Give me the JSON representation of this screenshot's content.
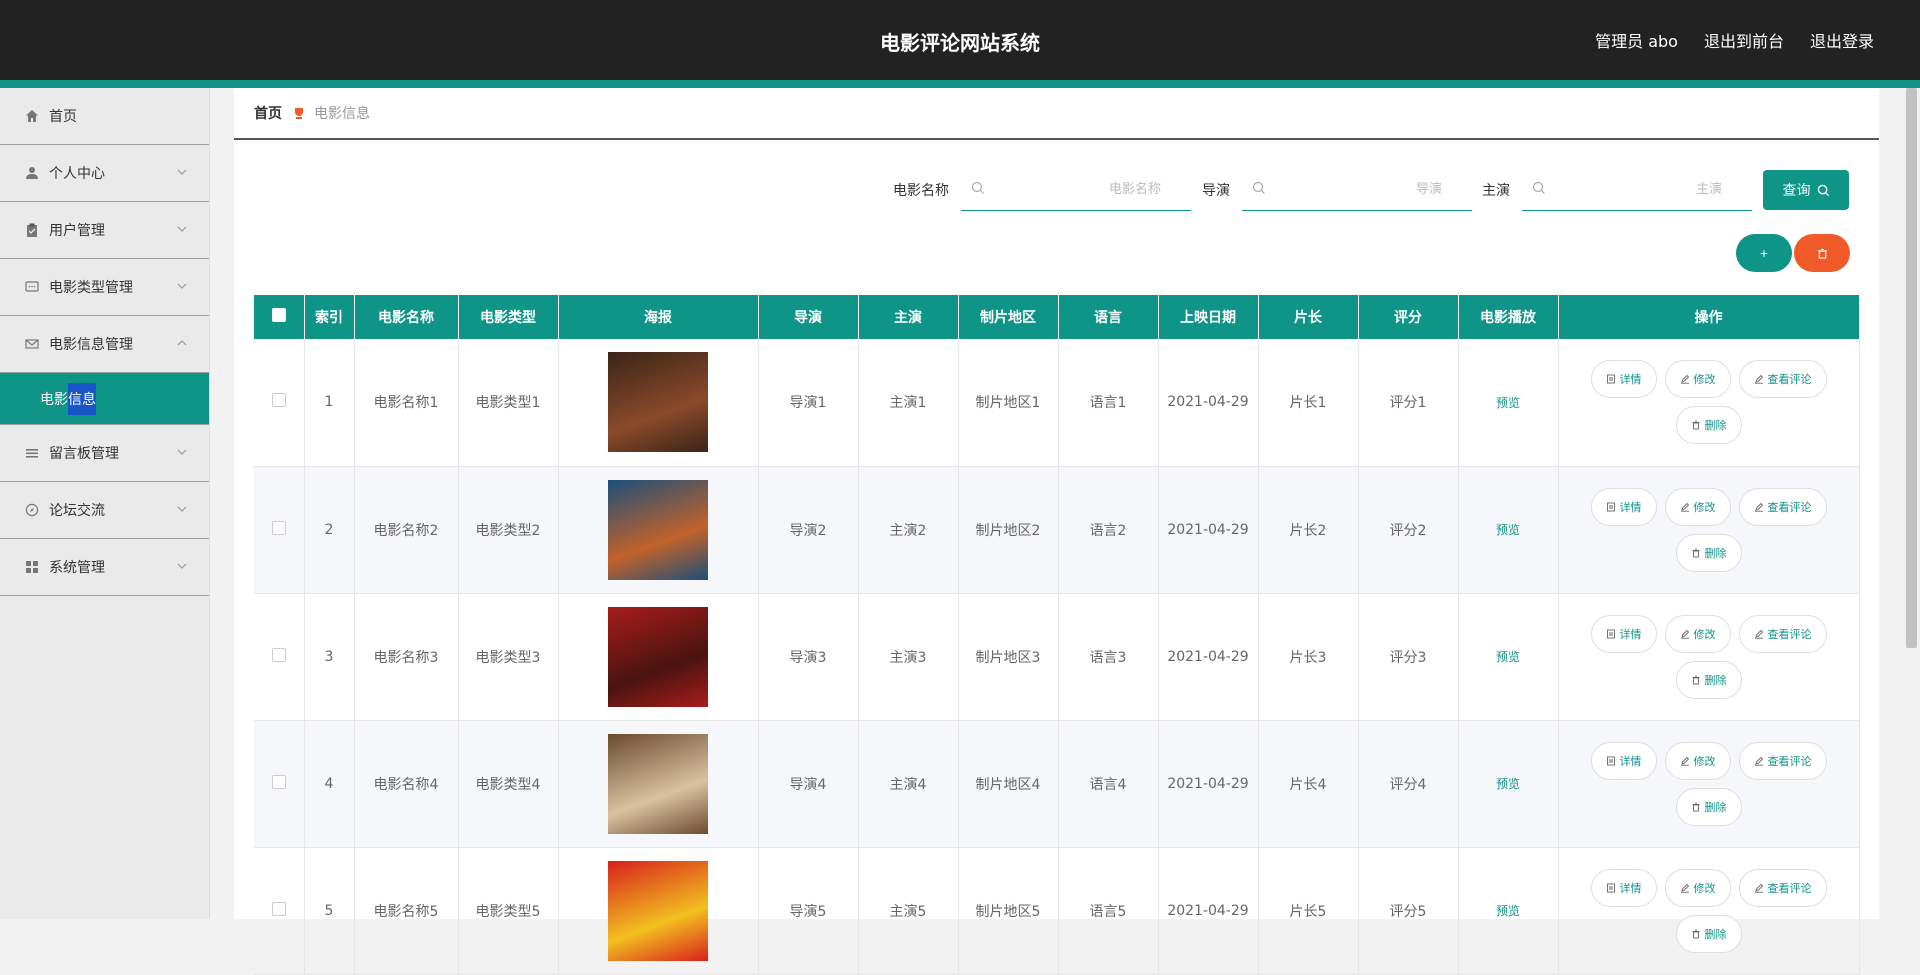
{
  "header": {
    "title": "电影评论网站系统",
    "user_label": "管理员 abo",
    "to_front": "退出到前台",
    "logout": "退出登录"
  },
  "sidebar": {
    "items": [
      {
        "label": "首页",
        "icon": "home-icon"
      },
      {
        "label": "个人中心",
        "icon": "user-icon"
      },
      {
        "label": "用户管理",
        "icon": "clipboard-icon"
      },
      {
        "label": "电影类型管理",
        "icon": "chat-icon"
      },
      {
        "label": "电影信息管理",
        "icon": "mail-icon"
      },
      {
        "label": "留言板管理",
        "icon": "list-icon"
      },
      {
        "label": "论坛交流",
        "icon": "compass-icon"
      },
      {
        "label": "系统管理",
        "icon": "grid-icon"
      }
    ],
    "sub_active_pre": "电影",
    "sub_active_hl": "信息"
  },
  "breadcrumb": {
    "home": "首页",
    "current": "电影信息"
  },
  "search": {
    "name_label": "电影名称",
    "name_placeholder": "电影名称",
    "director_label": "导演",
    "director_placeholder": "导演",
    "actor_label": "主演",
    "actor_placeholder": "主演",
    "query_label": "查询"
  },
  "actions": {
    "add": "+",
    "delete_icon": "trash-icon"
  },
  "table": {
    "columns": [
      "索引",
      "电影名称",
      "电影类型",
      "海报",
      "导演",
      "主演",
      "制片地区",
      "语言",
      "上映日期",
      "片长",
      "评分",
      "电影播放",
      "操作"
    ],
    "preview_label": "预览",
    "op_labels": {
      "detail": "详情",
      "edit": "修改",
      "comments": "查看评论",
      "delete": "删除"
    },
    "rows": [
      {
        "index": "1",
        "name": "电影名称1",
        "type": "电影类型1",
        "director": "导演1",
        "actor": "主演1",
        "region": "制片地区1",
        "language": "语言1",
        "date": "2021-04-29",
        "length": "片长1",
        "score": "评分1",
        "poster_colors": [
          "#3a2418",
          "#8a4a2a"
        ]
      },
      {
        "index": "2",
        "name": "电影名称2",
        "type": "电影类型2",
        "director": "导演2",
        "actor": "主演2",
        "region": "制片地区2",
        "language": "语言2",
        "date": "2021-04-29",
        "length": "片长2",
        "score": "评分2",
        "poster_colors": [
          "#1c4f7a",
          "#c2622a"
        ]
      },
      {
        "index": "3",
        "name": "电影名称3",
        "type": "电影类型3",
        "director": "导演3",
        "actor": "主演3",
        "region": "制片地区3",
        "language": "语言3",
        "date": "2021-04-29",
        "length": "片长3",
        "score": "评分3",
        "poster_colors": [
          "#a81c1c",
          "#4a1410"
        ]
      },
      {
        "index": "4",
        "name": "电影名称4",
        "type": "电影类型4",
        "director": "导演4",
        "actor": "主演4",
        "region": "制片地区4",
        "language": "语言4",
        "date": "2021-04-29",
        "length": "片长4",
        "score": "评分4",
        "poster_colors": [
          "#6b4a2e",
          "#d9c2a0"
        ]
      },
      {
        "index": "5",
        "name": "电影名称5",
        "type": "电影类型5",
        "director": "导演5",
        "actor": "主演5",
        "region": "制片地区5",
        "language": "语言5",
        "date": "2021-04-29",
        "length": "片长5",
        "score": "评分5",
        "poster_colors": [
          "#d8201c",
          "#f2c020"
        ]
      }
    ]
  },
  "colors": {
    "accent": "#0f9488",
    "danger": "#f05a28",
    "header": "#222222",
    "sidebar": "#eaeaea"
  }
}
